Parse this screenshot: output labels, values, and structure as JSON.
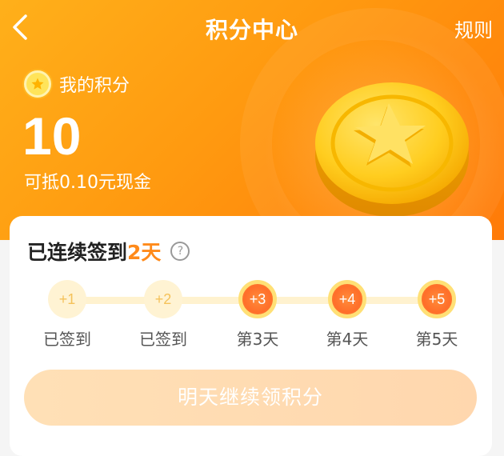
{
  "header": {
    "title": "积分中心",
    "rules_label": "规则",
    "points_label": "我的积分",
    "points_value": "10",
    "cash_text": "可抵0.10元现金"
  },
  "checkin": {
    "streak_prefix": "已连续签到",
    "streak_days": "2天",
    "days": [
      {
        "reward": "+1",
        "label": "已签到",
        "state": "done"
      },
      {
        "reward": "+2",
        "label": "已签到",
        "state": "done"
      },
      {
        "reward": "+3",
        "label": "第3天",
        "state": "todo"
      },
      {
        "reward": "+4",
        "label": "第4天",
        "state": "todo"
      },
      {
        "reward": "+5",
        "label": "第5天",
        "state": "todo"
      }
    ],
    "cta_label": "明天继续领积分"
  },
  "colors": {
    "accent": "#ff8a1a",
    "header_gradient_start": "#ffb01a",
    "header_gradient_end": "#ff7a08"
  },
  "icons": [
    "back-arrow-icon",
    "star-badge-icon",
    "gold-coin-star-icon",
    "help-question-icon"
  ]
}
